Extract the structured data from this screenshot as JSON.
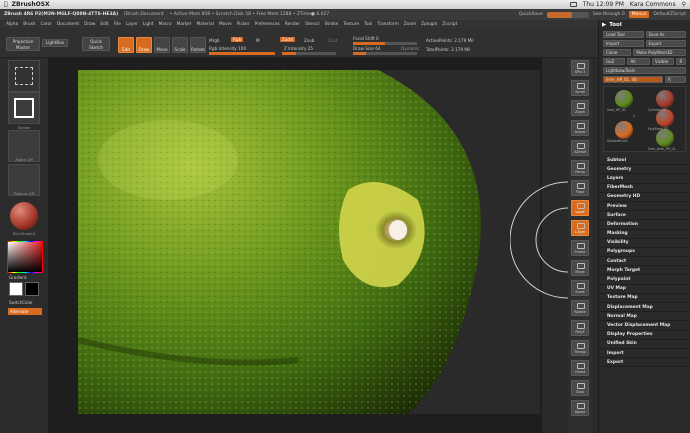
{
  "mac": {
    "app_name": "ZBrushOSX",
    "time": "Thu 12:09 PM",
    "user": "Kara Commons"
  },
  "title": {
    "version": "ZBrush 4R6 P2(M3N-MGLF-Q88N-4TTS-HE3A)",
    "doc": "[Brush Document",
    "mem": "• Active Mem 858 • Scratch Disk 58 • Free Mem 1288 • ZTime● 6.027",
    "quicksave": "QuickSave",
    "seethrough": "See-through 0",
    "menus_btn": "Menus",
    "script": "DefaultZScript"
  },
  "menus": [
    "Alpha",
    "Brush",
    "Color",
    "Document",
    "Draw",
    "Edit",
    "File",
    "Layer",
    "Light",
    "Macro",
    "Marker",
    "Material",
    "Movie",
    "Picker",
    "Preferences",
    "Render",
    "Stencil",
    "Stroke",
    "Texture",
    "Tool",
    "Transform",
    "Zoom",
    "Zplugin",
    "Zscript"
  ],
  "shelf": {
    "projection": "Projection Master",
    "lightbox": "LightBox",
    "quicksketch": "Quick Sketch",
    "edit": "Edit",
    "draw": "Draw",
    "move": "Move",
    "scale": "Scale",
    "rotate": "Rotate",
    "mrgb": "Mrgb",
    "rgb": "Rgb",
    "m": "M",
    "rgb_intensity": "Rgb Intensity 100",
    "zadd": "Zadd",
    "zsub": "Zsub",
    "zcut": "Zcut",
    "z_intensity": "Z Intensity 25",
    "focal_shift": "Focal Shift 0",
    "draw_size": "Draw Size 64",
    "dynamic": "Dynamic",
    "active_points": "ActivePoints: 2.179 Mil",
    "total_points": "TotalPoints: 2.179 Mil"
  },
  "left": {
    "brush_cap": "Brush",
    "stroke_cap": "Stroke",
    "alpha_cap": "Alpha Off",
    "texture_cap": "Texture Off",
    "material_cap": "SkinShade4",
    "gradient": "Gradient",
    "switchcolor": "SwitchColor",
    "alternate": "Alternate"
  },
  "right_shelf": [
    "SPix 3",
    "Scroll",
    "Zoom",
    "Actual",
    "AAHalf",
    "Persp",
    "Floor",
    "Local",
    "L.Sym",
    "Frame",
    "Move",
    "Scale",
    "Rotate",
    "PolyF",
    "Transp",
    "Ghost",
    "Solo",
    "Xpose"
  ],
  "tool": {
    "title": "Tool",
    "load_tool": "Load Tool",
    "save_as": "Save As",
    "import": "Import",
    "export": "Export",
    "clone": "Clone",
    "make_polymesh": "Make PolyMesh3D",
    "goz": "GoZ",
    "all": "All",
    "visible": "Visible",
    "r": "R",
    "lightbox_tools": "Lightbox▸Tools",
    "current_tool": "lime_HP_01. 48",
    "r2": "R",
    "thumbs": [
      {
        "label": "lime_HP_01",
        "color": "#5f8a1c"
      },
      {
        "label": "Cylinder3D",
        "color": "#a83a2a"
      },
      {
        "label": "PolyMesh3D",
        "color": "#c0432a"
      },
      {
        "label": "SimpleBrush",
        "color": "#d86b1f"
      },
      {
        "label": "lime_lime_HP_01",
        "color": "#5f8a1c"
      }
    ],
    "thumb_count": "2",
    "items": [
      "Subtool",
      "Geometry",
      "Layers",
      "FiberMesh",
      "Geometry HD",
      "Preview",
      "Surface",
      "Deformation",
      "Masking",
      "Visibility",
      "Polygroups",
      "Contact",
      "Morph Target",
      "Polypaint",
      "UV Map",
      "Texture Map",
      "Displacement Map",
      "Normal Map",
      "Vector Displacement Map",
      "Display Properties",
      "Unified Skin",
      "Import",
      "Export"
    ]
  }
}
